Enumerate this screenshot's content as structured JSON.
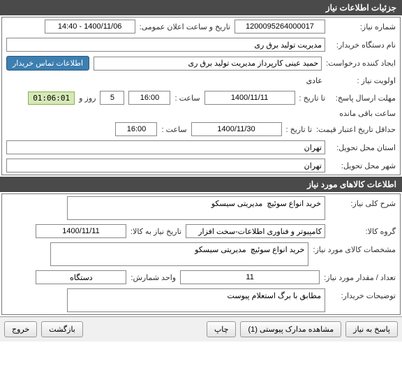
{
  "header1": "جزئیات اطلاعات نیاز",
  "need_number_label": "شماره نیاز:",
  "need_number": "1200095264000017",
  "public_date_label": "تاریخ و ساعت اعلان عمومی:",
  "public_date": "1400/11/06 - 14:40",
  "buyer_org_label": "نام دستگاه خریدار:",
  "buyer_org": "مدیریت تولید برق ری",
  "requester_label": "ایجاد کننده درخواست:",
  "requester": "حمید عینی کارپرداز مدیریت تولید برق ری",
  "contact_btn": "اطلاعات تماس خریدار",
  "priority_label": "اولویت نیاز :",
  "priority": "عادی",
  "deadline_send_label": "مهلت ارسال پاسخ:",
  "to_date_label": "تا تاریخ :",
  "deadline_date": "1400/11/11",
  "time_label": "ساعت :",
  "deadline_time": "16:00",
  "days_value": "5",
  "days_and": "روز و",
  "timer": "01:06:01",
  "remaining": "ساعت باقی مانده",
  "price_validity_label": "حداقل تاریخ اعتبار قیمت:",
  "price_validity_date": "1400/11/30",
  "price_validity_time": "16:00",
  "delivery_province_label": "استان محل تحویل:",
  "delivery_province": "تهران",
  "delivery_city_label": "شهر محل تحویل:",
  "delivery_city": "تهران",
  "header2": "اطلاعات کالاهای مورد نیاز",
  "desc_label": "شرح کلی نیاز:",
  "desc": "خرید انواع سوئیچ  مدیریتی سیسکو",
  "group_label": "گروه کالا:",
  "group": "کامپیوتر و فناوری اطلاعات-سخت افزار",
  "need_date_label": "تاریخ نیاز به کالا:",
  "need_date": "1400/11/11",
  "spec_label": "مشخصات کالای مورد نیاز:",
  "spec": "خرید انواع سوئیچ  مدیریتی سیسکو",
  "qty_label": "تعداد / مقدار مورد نیاز:",
  "qty": "11",
  "unit_label": "واحد شمارش:",
  "unit": "دستگاه",
  "buyer_notes_label": "توضیحات خریدار:",
  "buyer_notes": "مطابق با برگ استعلام پیوست",
  "btn_reply": "پاسخ به نیاز",
  "btn_attach": "مشاهده مدارک پیوستی (1)",
  "btn_print": "چاپ",
  "btn_back": "بازگشت",
  "btn_exit": "خروج"
}
